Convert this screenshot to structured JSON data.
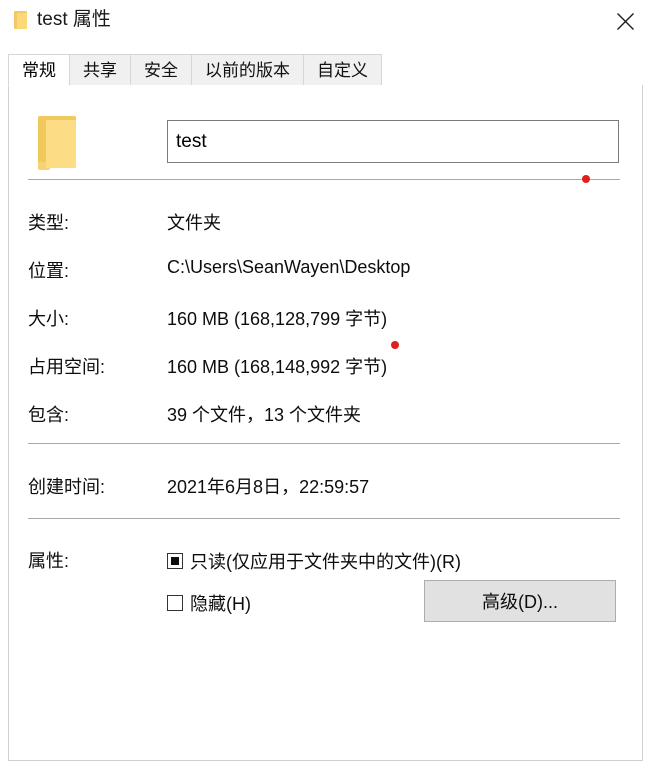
{
  "window": {
    "title": "test 属性",
    "folder_icon": "folder-icon",
    "close_icon": "close-icon"
  },
  "tabs": [
    {
      "label": "常规",
      "active": true
    },
    {
      "label": "共享",
      "active": false
    },
    {
      "label": "安全",
      "active": false
    },
    {
      "label": "以前的版本",
      "active": false
    },
    {
      "label": "自定义",
      "active": false
    }
  ],
  "header": {
    "icon": "folder-icon",
    "name_value": "test"
  },
  "properties": [
    {
      "label": "类型:",
      "value": "文件夹"
    },
    {
      "label": "位置:",
      "value": "C:\\Users\\SeanWayen\\Desktop"
    },
    {
      "label": "大小:",
      "value": "160 MB (168,128,799 字节)"
    },
    {
      "label": "占用空间:",
      "value": "160 MB (168,148,992 字节)"
    },
    {
      "label": "包含:",
      "value": "39 个文件，13 个文件夹"
    },
    {
      "label": "创建时间:",
      "value": "2021年6月8日，22:59:57"
    }
  ],
  "attributes": {
    "label": "属性:",
    "readonly": {
      "text": "只读(仅应用于文件夹中的文件)(R)",
      "state": "indeterminate"
    },
    "hidden": {
      "text": "隐藏(H)",
      "state": "unchecked"
    },
    "advanced_button": "高级(D)..."
  },
  "annotations": {
    "dot_color": "#e02020",
    "dots": [
      {
        "name": "red-dot-name-field"
      },
      {
        "name": "red-dot-disk-size"
      }
    ]
  },
  "colors": {
    "folder_yellow": "#fcdd86",
    "folder_yellow_dark": "#f0c85c",
    "tab_inactive_bg": "#f0f0f0",
    "button_bg": "#e1e1e1",
    "separator": "#a9a9a9"
  }
}
